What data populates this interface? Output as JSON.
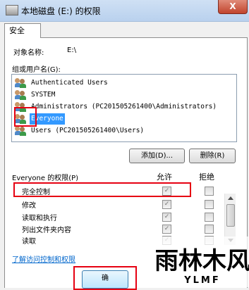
{
  "window": {
    "title": "本地磁盘 (E:) 的权限",
    "close_label": "X"
  },
  "tabs": [
    {
      "label": "安全"
    }
  ],
  "object": {
    "label": "对象名称:",
    "value": "E:\\"
  },
  "groups": {
    "label": "组或用户名(G):",
    "items": [
      {
        "label": "Authenticated Users",
        "icon": "users-group-icon"
      },
      {
        "label": "SYSTEM",
        "icon": "users-group-icon"
      },
      {
        "label": "Administrators (PC201505261400\\Administrators)",
        "icon": "users-group-icon"
      },
      {
        "label": "Everyone",
        "icon": "users-group-icon",
        "selected": true
      },
      {
        "label": "Users (PC201505261400\\Users)",
        "icon": "users-group-icon"
      }
    ]
  },
  "buttons": {
    "add": "添加(D)...",
    "remove": "删除(R)",
    "ok": "确"
  },
  "permissions": {
    "title": "Everyone 的权限(P)",
    "allow_header": "允许",
    "deny_header": "拒绝",
    "rows": [
      {
        "label": "完全控制",
        "allow": true,
        "deny": false
      },
      {
        "label": "修改",
        "allow": true,
        "deny": false
      },
      {
        "label": "读取和执行",
        "allow": true,
        "deny": false
      },
      {
        "label": "列出文件夹内容",
        "allow": true,
        "deny": false
      },
      {
        "label": "读取",
        "allow": true,
        "deny": false
      }
    ]
  },
  "link": "了解访问控制和权限",
  "watermark": {
    "main": "雨林木风",
    "sub": "YLMF"
  },
  "colors": {
    "highlight": "#e60012",
    "selection": "#3399ff",
    "link": "#0066cc"
  }
}
